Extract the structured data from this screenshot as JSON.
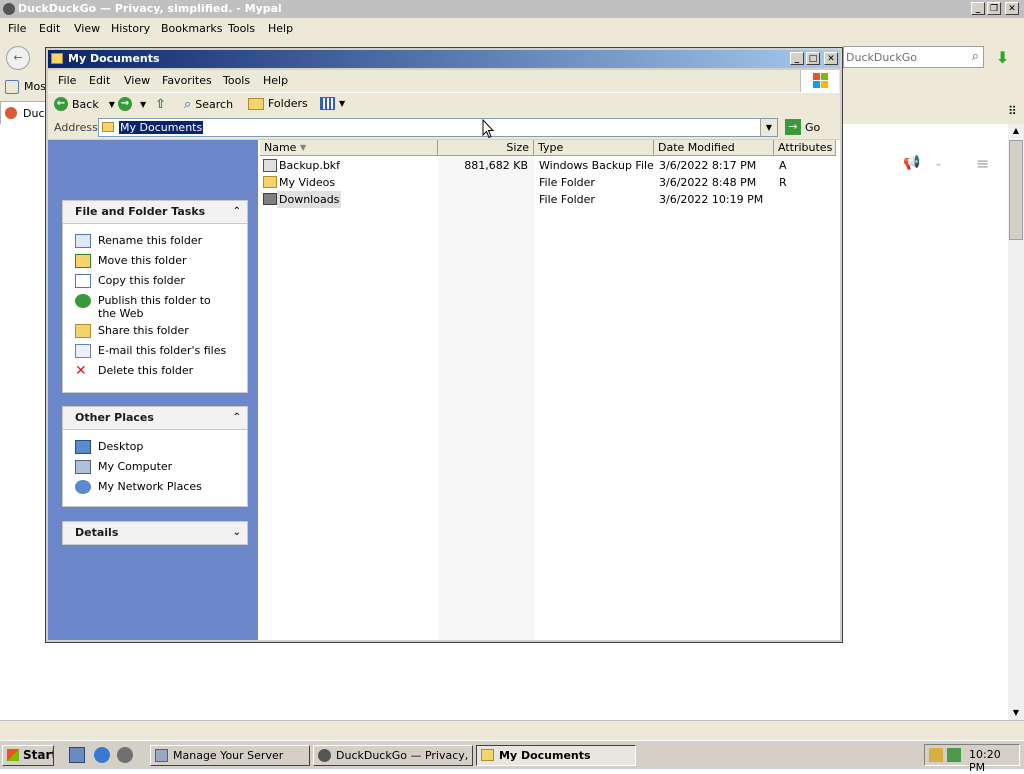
{
  "browser": {
    "title": "DuckDuckGo — Privacy, simplified. - Mypal",
    "menu": [
      "File",
      "Edit",
      "View",
      "History",
      "Bookmarks",
      "Tools",
      "Help"
    ],
    "search_placeholder": "DuckDuckGo",
    "bookmark_label": "Mos",
    "tab_label": "Duck"
  },
  "explorer": {
    "title": "My Documents",
    "menu": [
      "File",
      "Edit",
      "View",
      "Favorites",
      "Tools",
      "Help"
    ],
    "toolbar": {
      "back": "Back",
      "search": "Search",
      "folders": "Folders"
    },
    "address": {
      "label": "Address",
      "value": "My Documents",
      "go": "Go"
    },
    "panels": {
      "file_tasks": {
        "title": "File and Folder Tasks",
        "items": [
          "Rename this folder",
          "Move this folder",
          "Copy this folder",
          "Publish this folder to the Web",
          "Share this folder",
          "E-mail this folder's files",
          "Delete this folder"
        ]
      },
      "other_places": {
        "title": "Other Places",
        "items": [
          "Desktop",
          "My Computer",
          "My Network Places"
        ]
      },
      "details": {
        "title": "Details"
      }
    },
    "columns": [
      "Name",
      "Size",
      "Type",
      "Date Modified",
      "Attributes"
    ],
    "files": [
      {
        "name": "Backup.bkf",
        "size": "881,682 KB",
        "type": "Windows Backup File",
        "date": "3/6/2022 8:17 PM",
        "attr": "A"
      },
      {
        "name": "My Videos",
        "size": "",
        "type": "File Folder",
        "date": "3/6/2022 8:48 PM",
        "attr": "R"
      },
      {
        "name": "Downloads",
        "size": "",
        "type": "File Folder",
        "date": "3/6/2022 10:19 PM",
        "attr": ""
      }
    ]
  },
  "taskbar": {
    "start": "Start",
    "tasks": [
      "Manage Your Server",
      "DuckDuckGo — Privacy, ...",
      "My Documents"
    ],
    "clock": "10:20 PM"
  }
}
